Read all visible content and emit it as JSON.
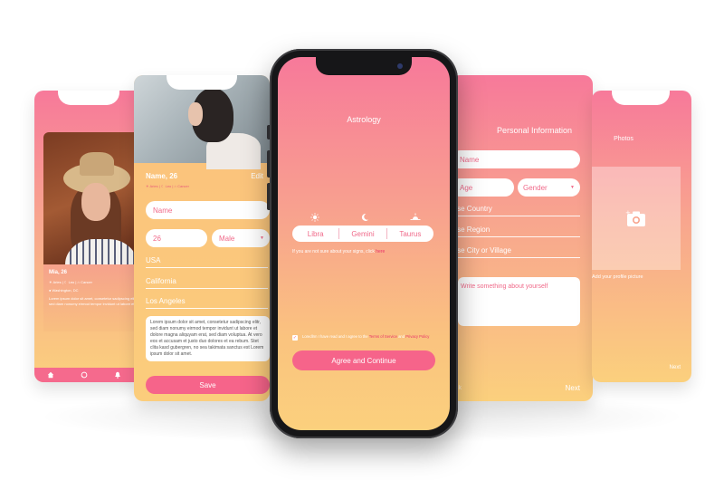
{
  "screen1": {
    "name": "Mia, 26",
    "signs": [
      "Aries",
      "Leo",
      "Cancer"
    ],
    "location": "Washington, DC",
    "bio": "Lorem ipsum dolor sit amet, consetetur sadipscing elitr, sed diam nonumy eirmod tempor invidunt ut labore et"
  },
  "screen2": {
    "name": "Name, 26",
    "edit_label": "Edit",
    "signs": [
      "Aries",
      "Leo",
      "Cancer"
    ],
    "name_field": "Name",
    "age_field": "26",
    "gender_field": "Male",
    "country": "USA",
    "region": "California",
    "city": "Los Angeles",
    "bio": "Lorem ipsum dolor sit amet, consetetur sadipscing elitr, sed diam nonumy eirmod tempor invidunt ut labore et dolore magna aliquyam erat, sed diam voluptua. At vero eos et accusam et justo duo dolores et ea rebum. Stet clita kasd gubergren, no sea takimata sanctus est Lorem ipsum dolor sit amet.",
    "save_label": "Save"
  },
  "center": {
    "title": "Astrology",
    "signs": [
      "Libra",
      "Gemini",
      "Taurus"
    ],
    "hint_text": "If you are not sure about your signs, click ",
    "hint_link": "here",
    "terms_text": "Loredlrm I have read and I agree to the ",
    "terms_link": "Terms of Service",
    "terms_and": " and ",
    "privacy_link": "Privacy Policy",
    "agree_label": "Agree and Continue"
  },
  "screen4": {
    "title": "Personal Information",
    "name_placeholder": "Name",
    "age_placeholder": "Age",
    "gender_placeholder": "Gender",
    "country_placeholder": "Choose Country",
    "region_placeholder": "Choose Region",
    "city_placeholder": "Choose City or Village",
    "bio_placeholder": "Write something about yourself",
    "back_label": "Back",
    "next_label": "Next"
  },
  "screen5": {
    "title": "Photos",
    "add_label": "Add your profile picture",
    "next_label": "Next"
  },
  "colors": {
    "accent": "#f6648a",
    "gradient_top": "#f7799a",
    "gradient_bottom": "#fbd07d"
  }
}
